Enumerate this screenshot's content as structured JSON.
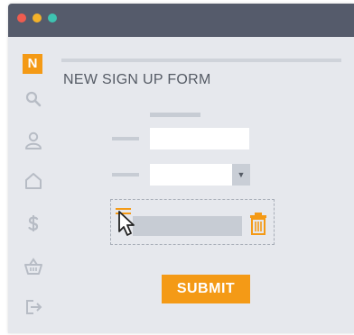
{
  "window": {
    "traffic_lights": [
      "close",
      "minimize",
      "zoom"
    ]
  },
  "sidebar": {
    "logo_letter": "N",
    "icons": [
      "search-icon",
      "user-icon",
      "home-icon",
      "dollar-icon",
      "basket-icon",
      "logout-icon"
    ]
  },
  "form": {
    "title": "NEW SIGN UP FORM",
    "submit_label": "SUBMIT"
  },
  "colors": {
    "accent": "#f49a16",
    "titlebar": "#555b6b",
    "background": "#e6e8ed",
    "placeholder_bar": "#c7ccd4"
  }
}
